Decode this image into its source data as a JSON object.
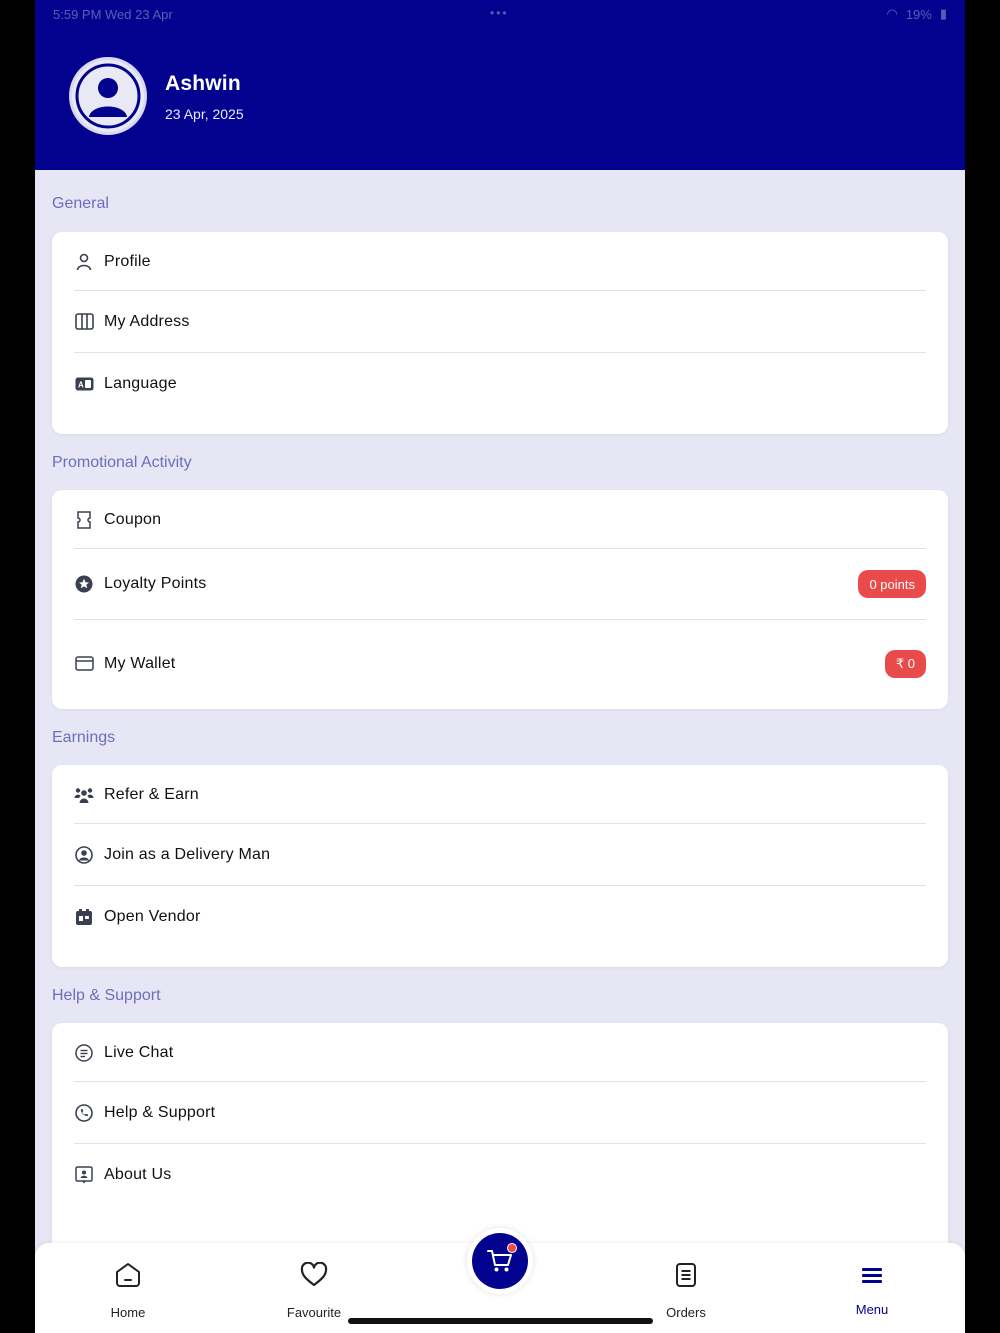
{
  "status_bar": {
    "time_date": "5:59 PM   Wed 23 Apr",
    "battery": "19%"
  },
  "user": {
    "name": "Ashwin",
    "date": "23 Apr, 2025"
  },
  "sections": {
    "general": {
      "title": "General",
      "items": [
        {
          "label": "Profile",
          "icon": "person-icon"
        },
        {
          "label": "My Address",
          "icon": "map-icon"
        },
        {
          "label": "Language",
          "icon": "language-icon"
        }
      ]
    },
    "promotional": {
      "title": "Promotional Activity",
      "items": [
        {
          "label": "Coupon",
          "icon": "coupon-icon"
        },
        {
          "label": "Loyalty Points",
          "icon": "star-badge-icon",
          "badge": "0 points"
        },
        {
          "label": "My Wallet",
          "icon": "wallet-icon",
          "badge": "₹ 0"
        }
      ]
    },
    "earnings": {
      "title": "Earnings",
      "items": [
        {
          "label": "Refer & Earn",
          "icon": "refer-icon"
        },
        {
          "label": "Join as a Delivery Man",
          "icon": "delivery-man-icon"
        },
        {
          "label": "Open Vendor",
          "icon": "store-icon"
        }
      ]
    },
    "help": {
      "title": "Help & Support",
      "items": [
        {
          "label": "Live Chat",
          "icon": "chat-icon"
        },
        {
          "label": "Help & Support",
          "icon": "phone-icon"
        },
        {
          "label": "About Us",
          "icon": "about-icon"
        }
      ]
    }
  },
  "nav": {
    "home": "Home",
    "favourite": "Favourite",
    "orders": "Orders",
    "menu": "Menu",
    "active": "menu"
  },
  "colors": {
    "primary": "#02028e",
    "background": "#e6e6f4",
    "section_title": "#6d6dbf",
    "badge": "#e94b4b"
  }
}
